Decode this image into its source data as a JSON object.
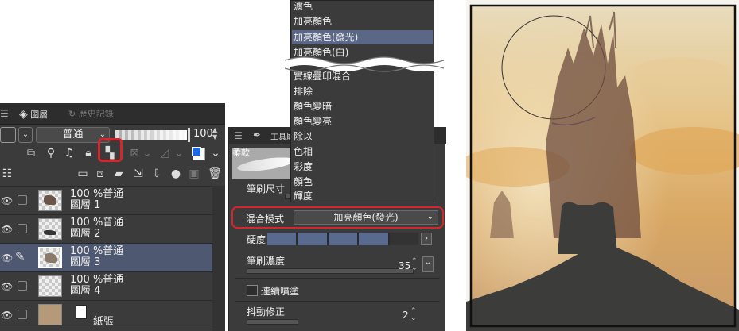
{
  "layer_panel": {
    "tabs": [
      {
        "label": "圖層"
      },
      {
        "label": "歷史記錄"
      }
    ],
    "blend_mode": "普通",
    "opacity_value": "100",
    "layers": [
      {
        "opacity_mode": "100 %普通",
        "name": "圖層 1",
        "selected": false
      },
      {
        "opacity_mode": "100 %普通",
        "name": "圖層 2",
        "selected": false
      },
      {
        "opacity_mode": "100 %普通",
        "name": "圖層 3",
        "selected": true
      },
      {
        "opacity_mode": "100 %普通",
        "name": "圖層 4",
        "selected": false
      }
    ],
    "paper_layer": "紙張"
  },
  "tool_panel": {
    "tab_label": "工具屬",
    "brush_name": "柔軟",
    "brush_size_label": "筆刷尺寸",
    "blend_mode_label": "混合模式",
    "blend_mode_value": "加亮顏色(發光)",
    "hardness_label": "硬度",
    "brush_density_label": "筆刷濃度",
    "brush_density_value": "35",
    "continuous_spray_label": "連續噴塗",
    "stabilization_label": "抖動修正",
    "stabilization_value": "2"
  },
  "blend_menu": {
    "items_top": [
      "濾色",
      "加亮顏色",
      "加亮顏色(發光)",
      "加亮顏色(白)"
    ],
    "selected_item": "加亮顏色(發光)",
    "items_bottom": [
      "實線疊印混合",
      "排除",
      "顏色變暗",
      "顏色變亮",
      "除以",
      "色相",
      "彩度",
      "顏色",
      "輝度"
    ]
  },
  "colors": {
    "highlight": "#d6262b",
    "selection": "#4e5870",
    "panel_bg": "#3b3b3b",
    "accent_blue": "#1f66e0"
  }
}
